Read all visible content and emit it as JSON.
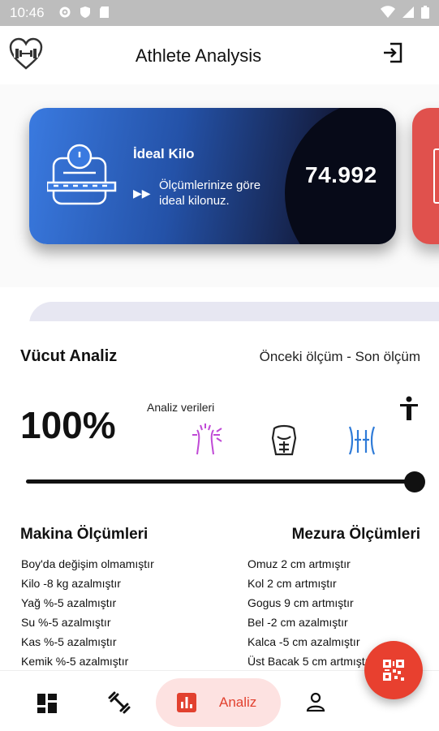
{
  "status_bar": {
    "time": "10:46"
  },
  "app_bar": {
    "title": "Athlete Analysis"
  },
  "ideal_card": {
    "title": "İdeal Kilo",
    "description": "Ölçümlerinize göre ideal kilonuz.",
    "value": "74.992"
  },
  "body_analysis": {
    "title": "Vücut Analiz",
    "compare_label": "Önceki ölçüm  - Son ölçüm",
    "percent": "100%",
    "analysis_label": "Analiz verileri",
    "slider_level": 1.0
  },
  "machine": {
    "title": "Makina Ölçümleri",
    "items": [
      "Boy'da değişim olmamıştır",
      "Kilo -8 kg azalmıştır",
      "Yağ %-5 azalmıştır",
      "Su %-5 azalmıştır",
      "Kas %-5 azalmıştır",
      "Kemik %-5 azalmıştır"
    ]
  },
  "tape": {
    "title": "Mezura Ölçümleri",
    "items": [
      "Omuz 2 cm artmıştır",
      "Kol 2 cm artmıştır",
      "Gogus 9 cm artmıştır",
      "Bel -2 cm azalmıştır",
      "Kalca -5 cm azalmıştır",
      "Üst Bacak 5 cm artmıştır"
    ]
  },
  "bottom_nav": {
    "active_label": "Analiz"
  },
  "colors": {
    "accent": "#e2412f",
    "card_blue": "#3a7ae0",
    "slim_icon": "#c04ad6",
    "lines_icon": "#2f7bd8"
  },
  "icons": [
    "heart-dumbbell-logo-icon",
    "logout-icon",
    "scale-icon",
    "play-icon",
    "qr-code-icon",
    "dashboard-icon",
    "dumbbell-icon",
    "bar-chart-icon",
    "user-icon",
    "person-icon"
  ]
}
